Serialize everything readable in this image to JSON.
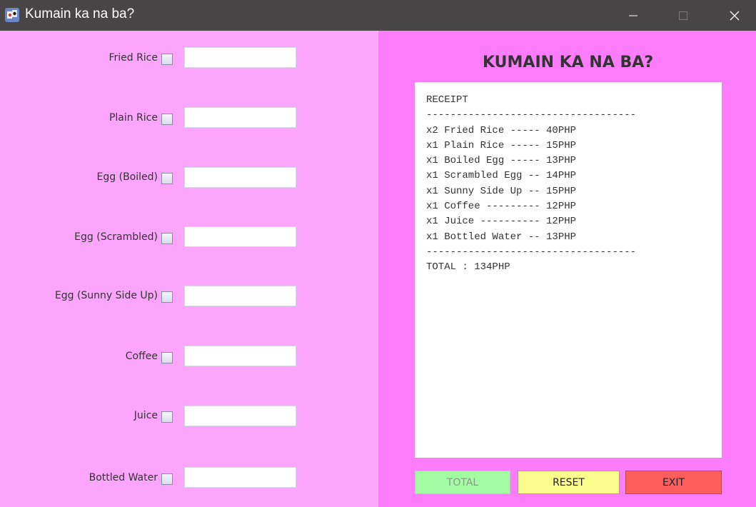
{
  "window": {
    "title": "Kumain ka na ba?",
    "minimize_glyph": "—",
    "maximize_glyph": "☐",
    "close_glyph": "✕"
  },
  "menu_items": [
    {
      "label": "Fried Rice",
      "checked": false,
      "quantity": ""
    },
    {
      "label": "Plain Rice",
      "checked": false,
      "quantity": ""
    },
    {
      "label": "Egg (Boiled)",
      "checked": false,
      "quantity": ""
    },
    {
      "label": "Egg (Scrambled)",
      "checked": false,
      "quantity": ""
    },
    {
      "label": "Egg (Sunny Side Up)",
      "checked": false,
      "quantity": ""
    },
    {
      "label": "Coffee",
      "checked": false,
      "quantity": ""
    },
    {
      "label": "Juice",
      "checked": false,
      "quantity": ""
    },
    {
      "label": "Bottled Water",
      "checked": false,
      "quantity": ""
    }
  ],
  "heading": "KUMAIN KA NA BA?",
  "receipt": {
    "lines": [
      "RECEIPT",
      "-----------------------------------",
      "x2 Fried Rice ----- 40PHP",
      "x1 Plain Rice ----- 15PHP",
      "x1 Boiled Egg ----- 13PHP",
      "x1 Scrambled Egg -- 14PHP",
      "x1 Sunny Side Up -- 15PHP",
      "x1 Coffee --------- 12PHP",
      "x1 Juice ---------- 12PHP",
      "x1 Bottled Water -- 13PHP",
      "-----------------------------------",
      "TOTAL : 134PHP"
    ]
  },
  "buttons": {
    "total": "TOTAL",
    "reset": "RESET",
    "exit": "EXIT"
  },
  "colors": {
    "titlebar": "#474545",
    "left_panel": "#fca5fc",
    "right_panel": "#fc7dfc",
    "total_button": "#a3fca3",
    "reset_button": "#fcfc8d",
    "exit_button": "#fc5d5d"
  },
  "icons": {
    "app": "app-icon",
    "minimize": "minimize-icon",
    "maximize": "maximize-icon",
    "close": "close-icon"
  }
}
